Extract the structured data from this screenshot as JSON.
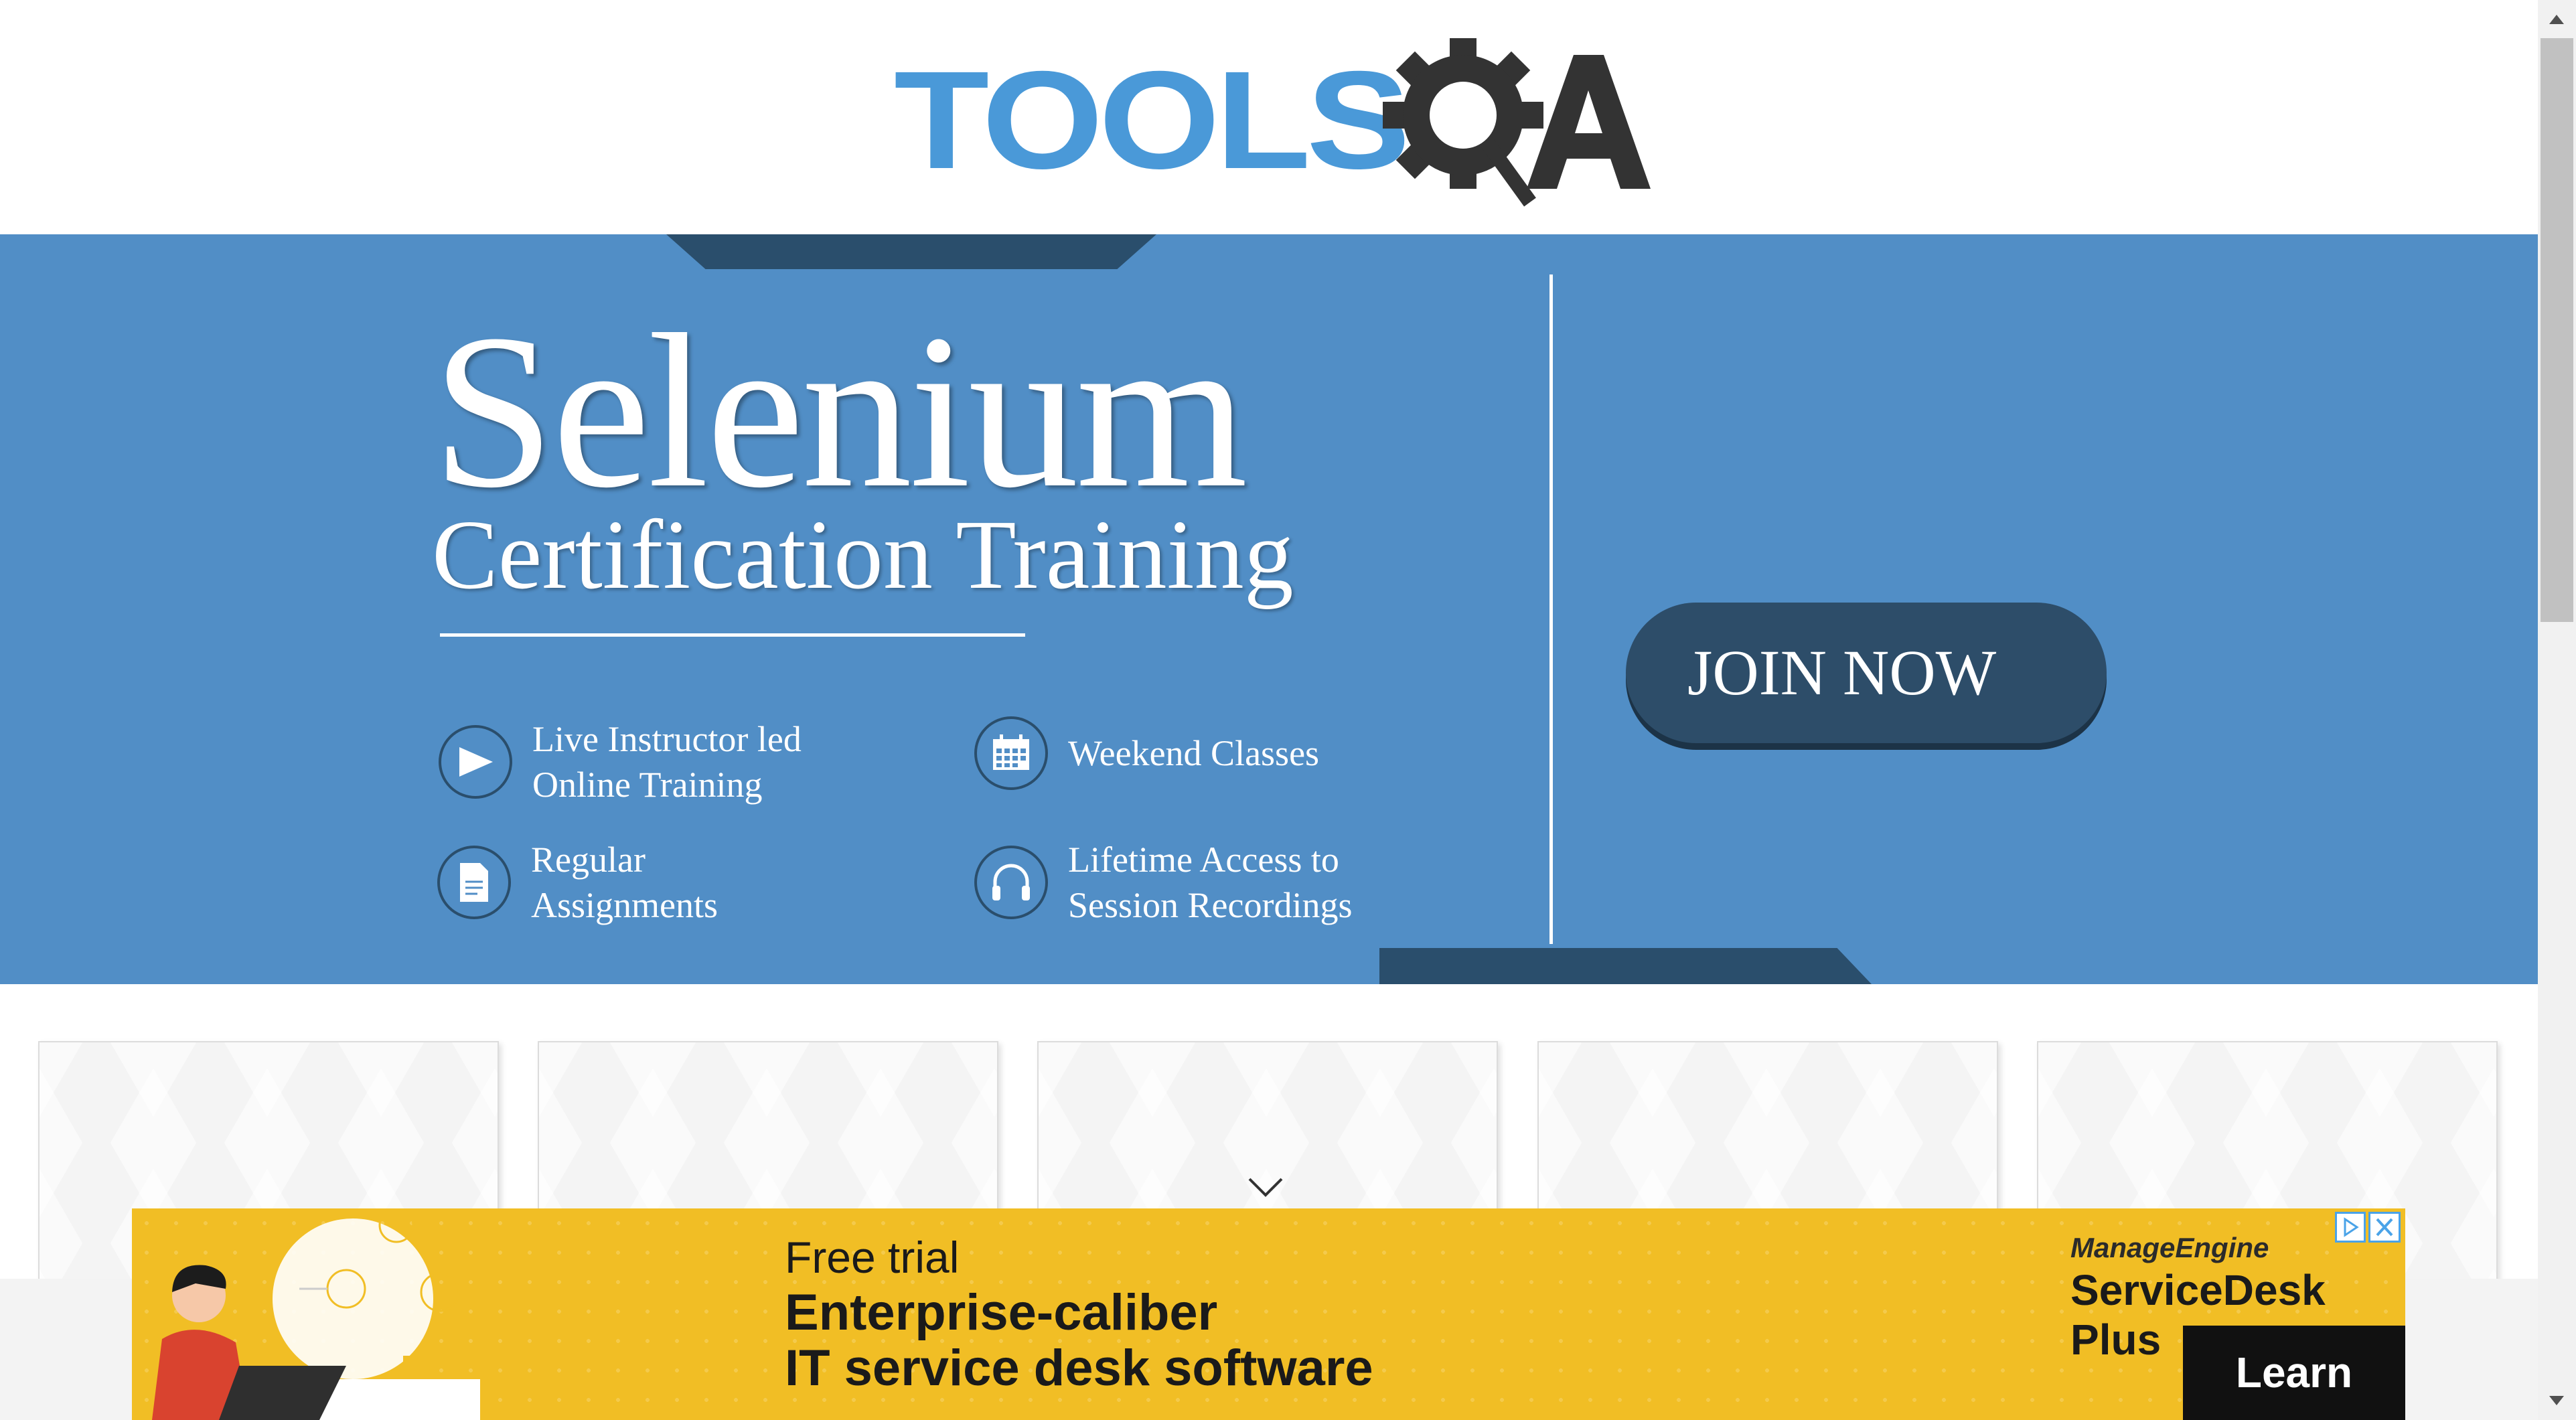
{
  "logo": {
    "text_part": "TOOLS",
    "symbol_part": "QA"
  },
  "banner": {
    "title": "Selenium",
    "subtitle": "Certification Training",
    "features": [
      {
        "icon": "play-icon",
        "line1": "Live Instructor led",
        "line2": "Online Training"
      },
      {
        "icon": "calendar-icon",
        "line1": "Weekend Classes",
        "line2": ""
      },
      {
        "icon": "document-icon",
        "line1": "Regular",
        "line2": "Assignments"
      },
      {
        "icon": "headphones-icon",
        "line1": "Lifetime Access to",
        "line2": "Session Recordings"
      }
    ],
    "cta_label": "JOIN NOW"
  },
  "ad": {
    "line1": "Free trial",
    "line2": "Enterprise-caliber",
    "line3": "IT service desk software",
    "brand": "ManageEngine",
    "product": "ServiceDesk Plus",
    "cta_label": "Learn more"
  },
  "colors": {
    "banner_blue": "#518ec6",
    "dark_navy": "#2a4e6c",
    "logo_blue": "#4a99d8",
    "logo_gray": "#333333",
    "ad_yellow": "#f1be25"
  }
}
